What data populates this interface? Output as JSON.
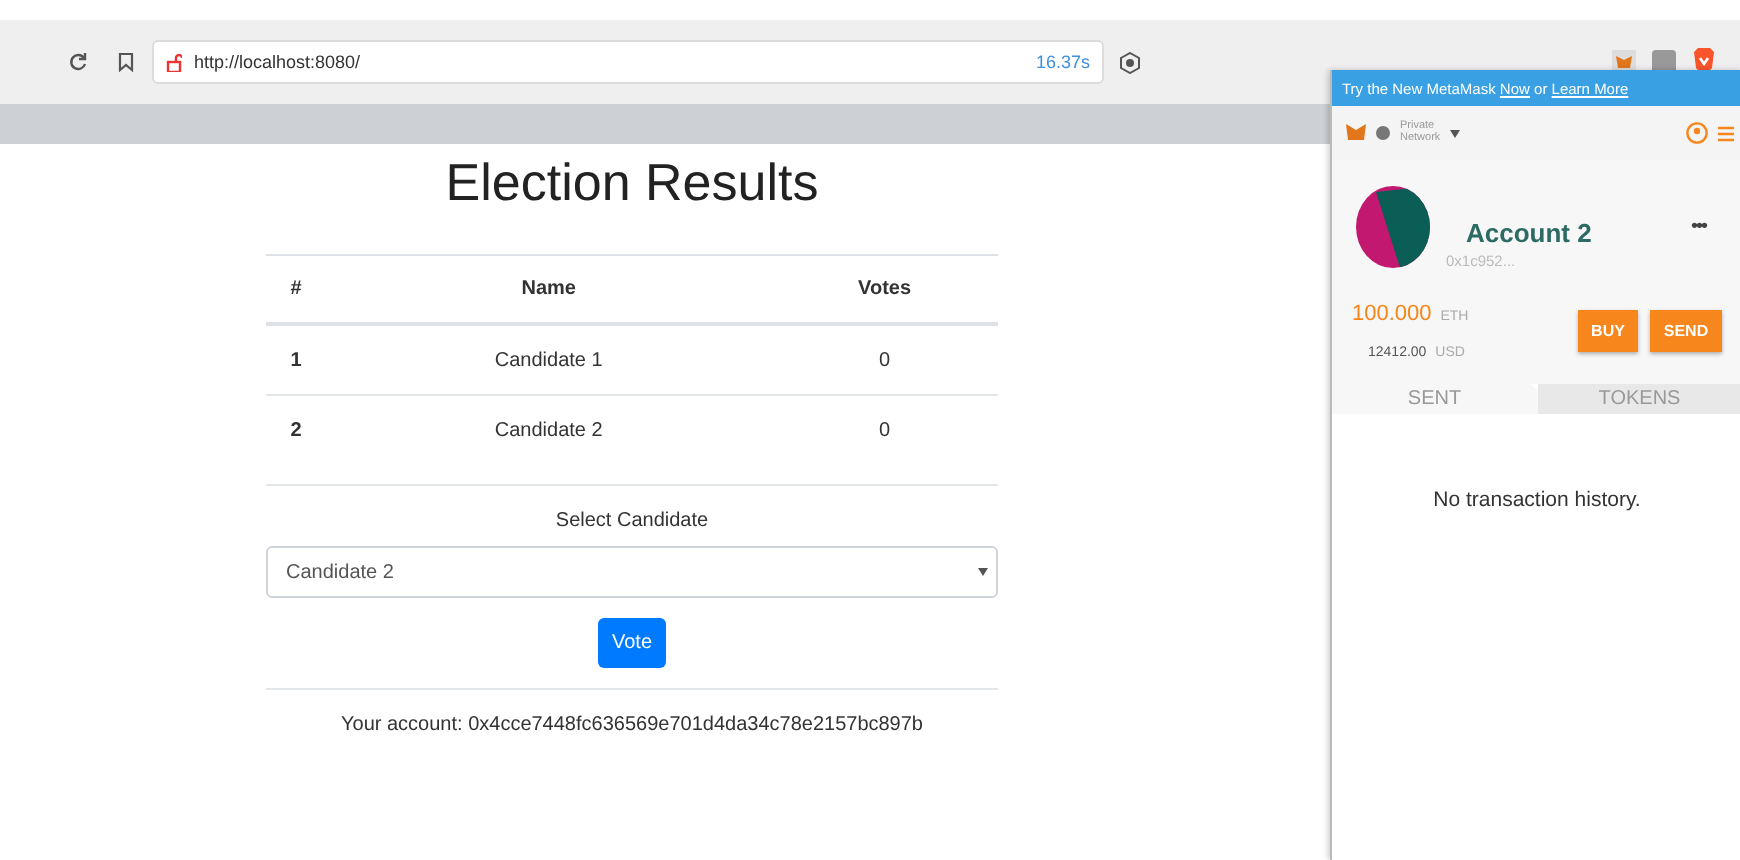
{
  "browser": {
    "url": "http://localhost:8080/",
    "load_time": "16.37s"
  },
  "page": {
    "title": "Election Results",
    "table": {
      "columns": [
        "#",
        "Name",
        "Votes"
      ],
      "rows": [
        {
          "index": "1",
          "name": "Candidate 1",
          "votes": "0"
        },
        {
          "index": "2",
          "name": "Candidate 2",
          "votes": "0"
        }
      ]
    },
    "select_label": "Select Candidate",
    "select_value": "Candidate 2",
    "vote_button": "Vote",
    "account": "Your account: 0x4cce7448fc636569e701d4da34c78e2157bc897b"
  },
  "wallet": {
    "banner": {
      "text": "Try the New MetaMask",
      "link1": "Now",
      "sep": "or",
      "link2": "Learn More"
    },
    "network": [
      "Private",
      "Network"
    ],
    "account_name": "Account 2",
    "more": "•••",
    "address": "0x1c952...",
    "balance": "100.000",
    "balance_unit": "ETH",
    "fiat": "12412.00",
    "fiat_unit": "USD",
    "buttons": [
      "BUY",
      "SEND"
    ],
    "tabs": [
      {
        "label": "SENT",
        "selected": true
      },
      {
        "label": "TOKENS",
        "selected": false
      }
    ],
    "empty": "No transaction history."
  }
}
